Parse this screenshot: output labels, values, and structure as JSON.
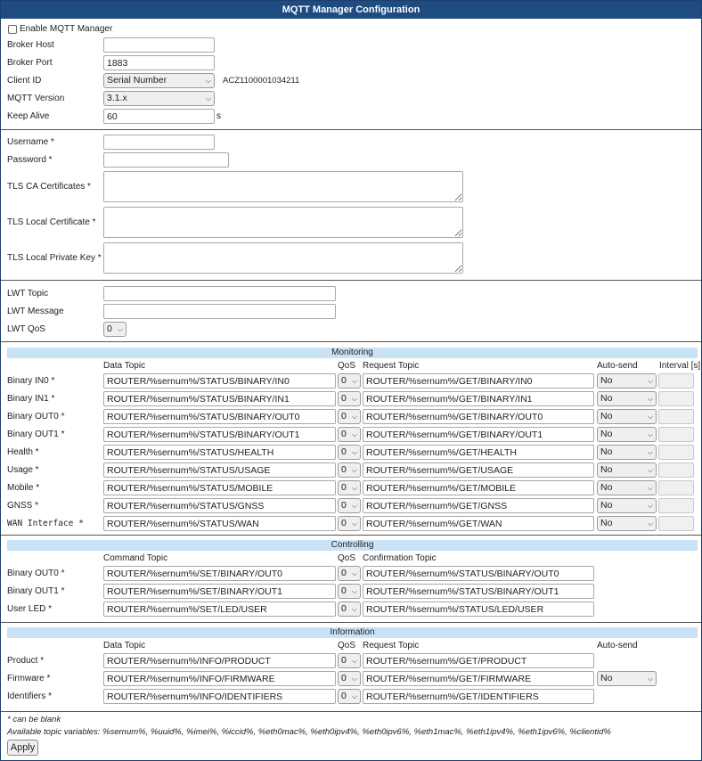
{
  "title": "MQTT Manager Configuration",
  "enable_label": "Enable MQTT Manager",
  "broker": {
    "host_label": "Broker Host",
    "host_value": "",
    "port_label": "Broker Port",
    "port_value": "1883",
    "client_id_label": "Client ID",
    "client_id_select": "Serial Number",
    "client_id_value": "ACZ1100001034211",
    "version_label": "MQTT Version",
    "version_select": "3.1.x",
    "keepalive_label": "Keep Alive",
    "keepalive_value": "60",
    "keepalive_unit": "s"
  },
  "auth": {
    "username_label": "Username *",
    "password_label": "Password *",
    "ca_label": "TLS CA Certificates *",
    "cert_label": "TLS Local Certificate *",
    "key_label": "TLS Local Private Key *"
  },
  "lwt": {
    "topic_label": "LWT Topic",
    "message_label": "LWT Message",
    "qos_label": "LWT QoS",
    "qos_value": "0"
  },
  "monitoring": {
    "header": "Monitoring",
    "col_data": "Data Topic",
    "col_qos": "QoS",
    "col_request": "Request Topic",
    "col_autosend": "Auto-send",
    "col_interval": "Interval [s]",
    "rows": [
      {
        "label": "Binary IN0 *",
        "data": "ROUTER/%sernum%/STATUS/BINARY/IN0",
        "qos": "0",
        "request": "ROUTER/%sernum%/GET/BINARY/IN0",
        "auto": "No"
      },
      {
        "label": "Binary IN1 *",
        "data": "ROUTER/%sernum%/STATUS/BINARY/IN1",
        "qos": "0",
        "request": "ROUTER/%sernum%/GET/BINARY/IN1",
        "auto": "No"
      },
      {
        "label": "Binary OUT0 *",
        "data": "ROUTER/%sernum%/STATUS/BINARY/OUT0",
        "qos": "0",
        "request": "ROUTER/%sernum%/GET/BINARY/OUT0",
        "auto": "No"
      },
      {
        "label": "Binary OUT1 *",
        "data": "ROUTER/%sernum%/STATUS/BINARY/OUT1",
        "qos": "0",
        "request": "ROUTER/%sernum%/GET/BINARY/OUT1",
        "auto": "No"
      },
      {
        "label": "Health *",
        "data": "ROUTER/%sernum%/STATUS/HEALTH",
        "qos": "0",
        "request": "ROUTER/%sernum%/GET/HEALTH",
        "auto": "No"
      },
      {
        "label": "Usage *",
        "data": "ROUTER/%sernum%/STATUS/USAGE",
        "qos": "0",
        "request": "ROUTER/%sernum%/GET/USAGE",
        "auto": "No"
      },
      {
        "label": "Mobile *",
        "data": "ROUTER/%sernum%/STATUS/MOBILE",
        "qos": "0",
        "request": "ROUTER/%sernum%/GET/MOBILE",
        "auto": "No"
      },
      {
        "label": "GNSS *",
        "data": "ROUTER/%sernum%/STATUS/GNSS",
        "qos": "0",
        "request": "ROUTER/%sernum%/GET/GNSS",
        "auto": "No"
      },
      {
        "label": "WAN Interface *",
        "data": "ROUTER/%sernum%/STATUS/WAN",
        "qos": "0",
        "request": "ROUTER/%sernum%/GET/WAN",
        "auto": "No"
      }
    ]
  },
  "controlling": {
    "header": "Controlling",
    "col_command": "Command Topic",
    "col_qos": "QoS",
    "col_confirm": "Confirmation Topic",
    "rows": [
      {
        "label": "Binary OUT0 *",
        "command": "ROUTER/%sernum%/SET/BINARY/OUT0",
        "qos": "0",
        "confirm": "ROUTER/%sernum%/STATUS/BINARY/OUT0"
      },
      {
        "label": "Binary OUT1 *",
        "command": "ROUTER/%sernum%/SET/BINARY/OUT1",
        "qos": "0",
        "confirm": "ROUTER/%sernum%/STATUS/BINARY/OUT1"
      },
      {
        "label": "User LED *",
        "command": "ROUTER/%sernum%/SET/LED/USER",
        "qos": "0",
        "confirm": "ROUTER/%sernum%/STATUS/LED/USER"
      }
    ]
  },
  "information": {
    "header": "Information",
    "col_data": "Data Topic",
    "col_qos": "QoS",
    "col_request": "Request Topic",
    "col_autosend": "Auto-send",
    "rows": [
      {
        "label": "Product *",
        "data": "ROUTER/%sernum%/INFO/PRODUCT",
        "qos": "0",
        "request": "ROUTER/%sernum%/GET/PRODUCT",
        "auto": ""
      },
      {
        "label": "Firmware *",
        "data": "ROUTER/%sernum%/INFO/FIRMWARE",
        "qos": "0",
        "request": "ROUTER/%sernum%/GET/FIRMWARE",
        "auto": "No"
      },
      {
        "label": "Identifiers *",
        "data": "ROUTER/%sernum%/INFO/IDENTIFIERS",
        "qos": "0",
        "request": "ROUTER/%sernum%/GET/IDENTIFIERS",
        "auto": ""
      }
    ]
  },
  "notes": {
    "blank": "* can be blank",
    "variables": "Available topic variables: %sernum%, %uuid%, %imei%, %iccid%, %eth0mac%, %eth0ipv4%, %eth0ipv6%, %eth1mac%, %eth1ipv4%, %eth1ipv6%, %clientid%"
  },
  "apply_label": "Apply"
}
